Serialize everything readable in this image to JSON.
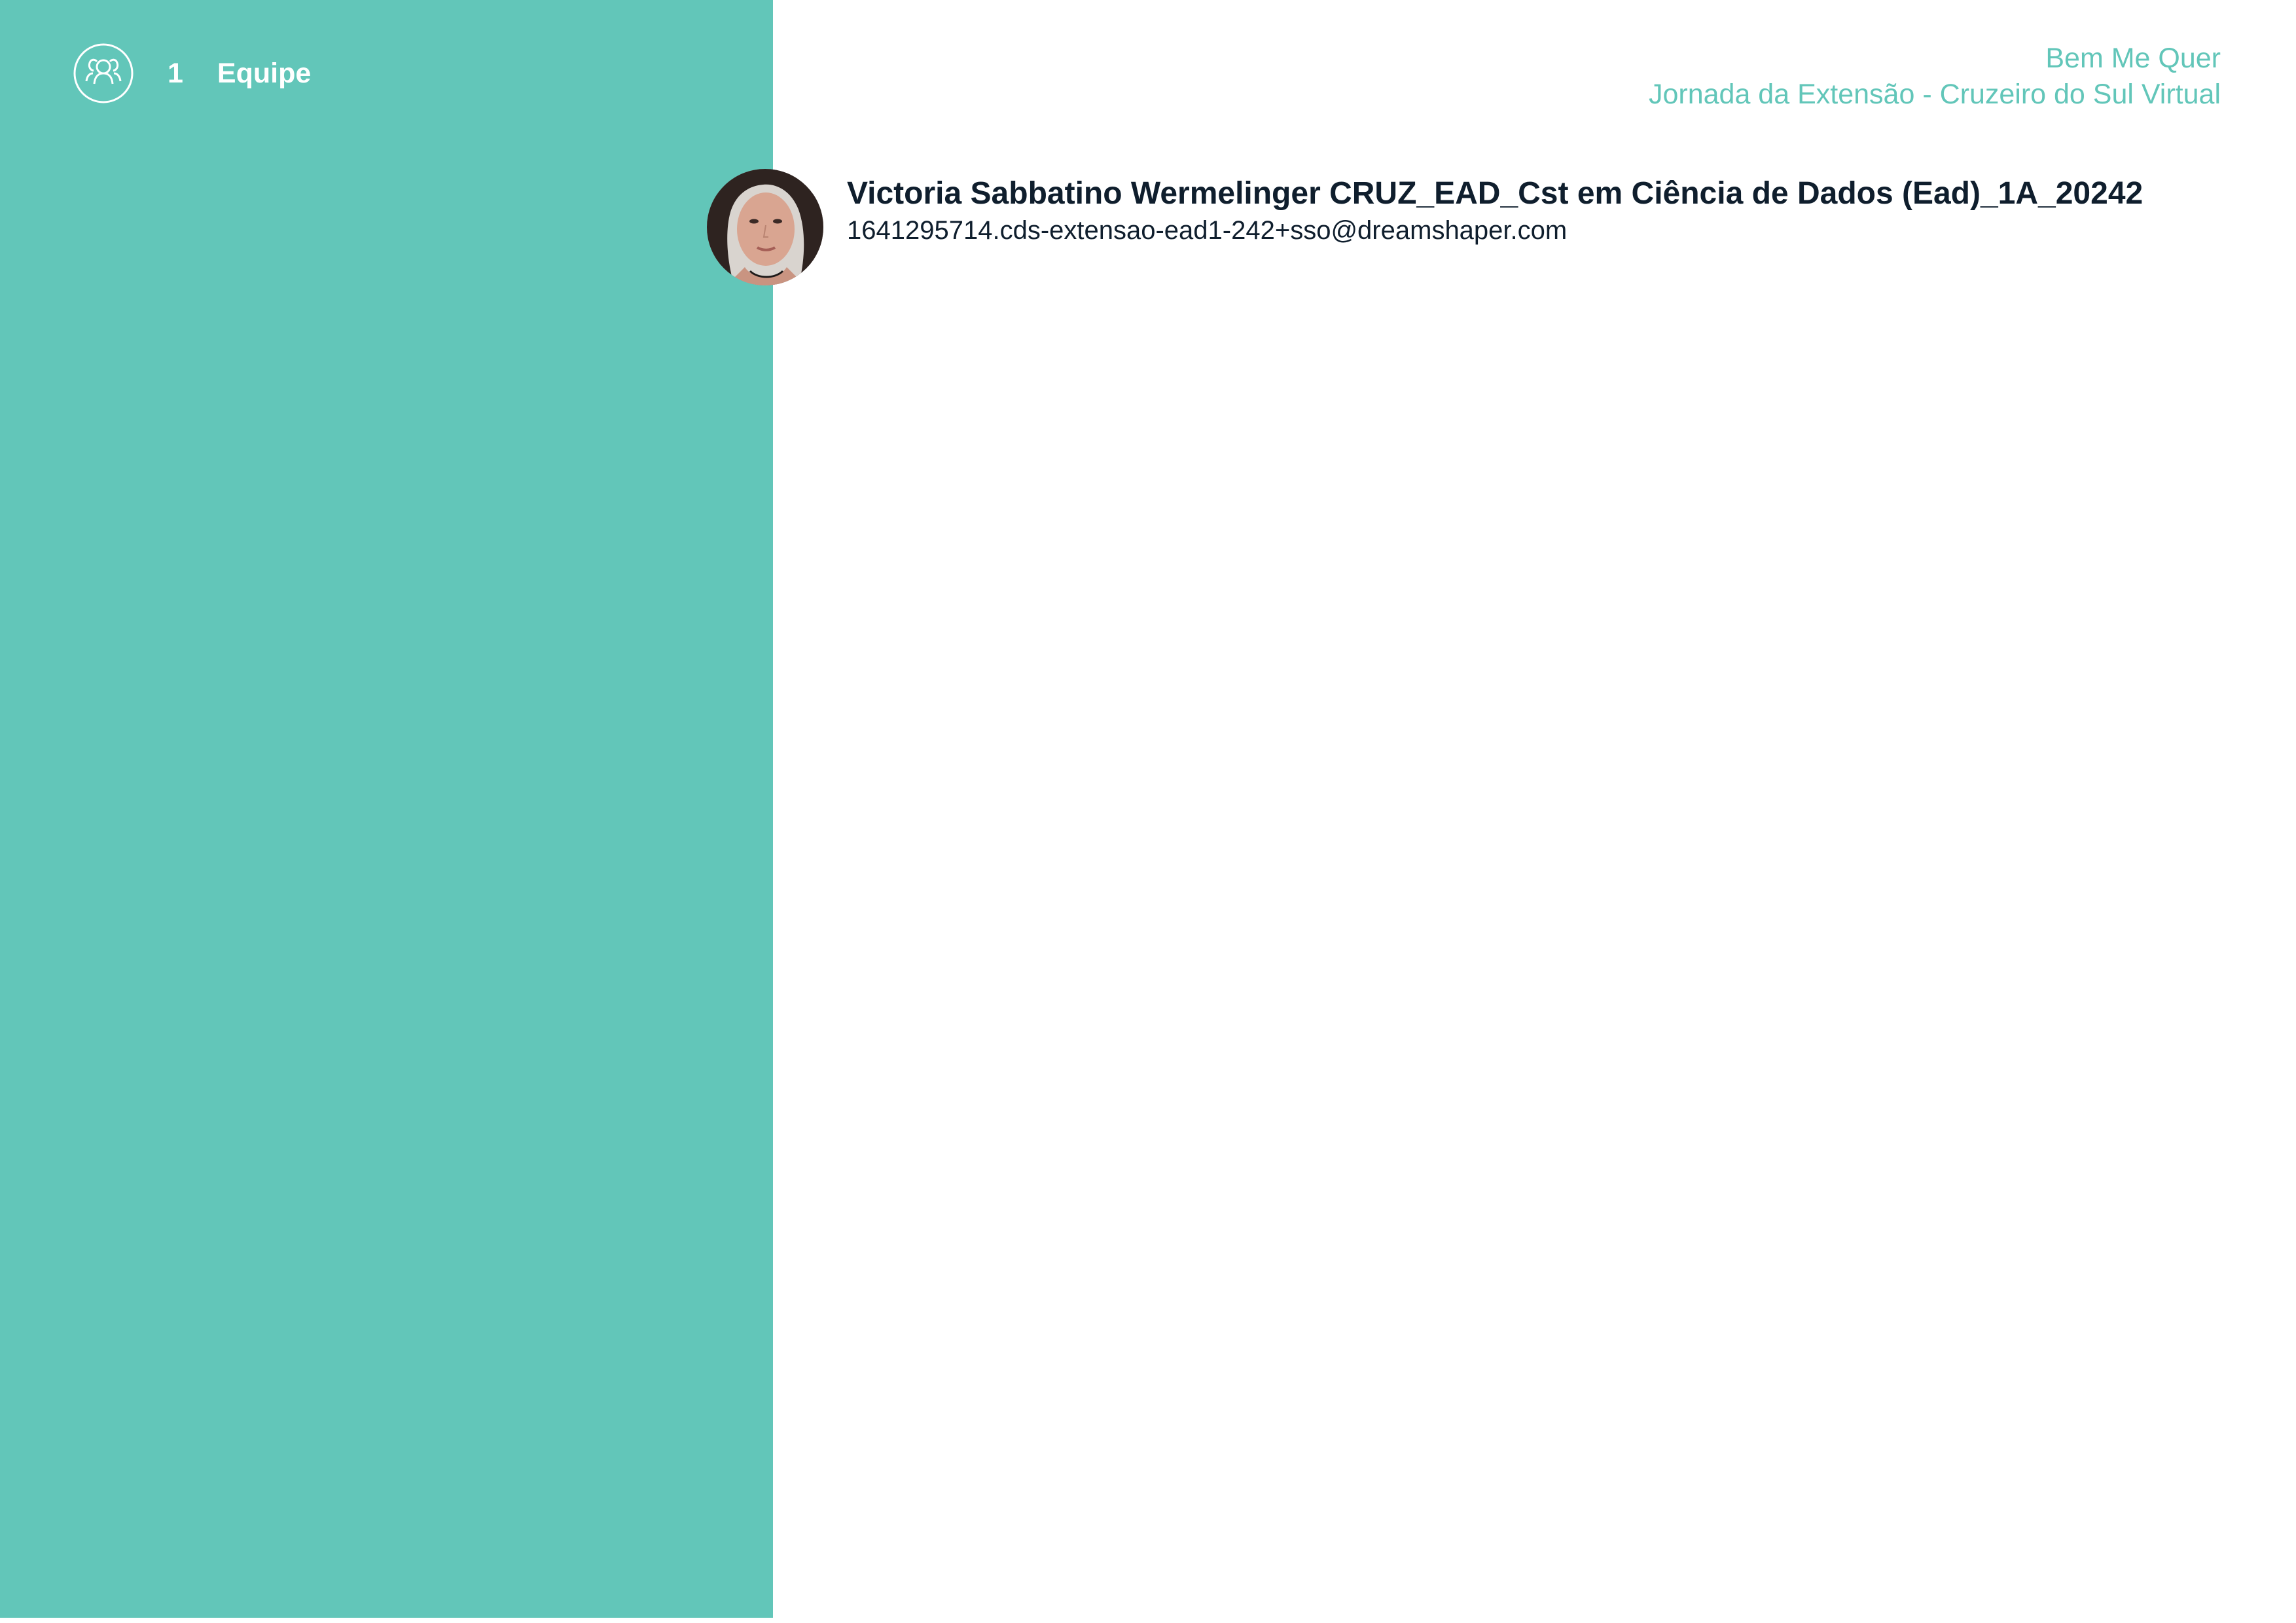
{
  "section": {
    "number": "1",
    "title": "Equipe",
    "icon": "team-icon"
  },
  "project": {
    "name": "Bem Me Quer",
    "program": "Jornada da Extensão - Cruzeiro do Sul Virtual"
  },
  "members": [
    {
      "name": "Victoria Sabbatino Wermelinger CRUZ_EAD_Cst em Ciência de Dados (Ead)_1A_20242",
      "email": "1641295714.cds-extensao-ead1-242+sso@dreamshaper.com"
    }
  ],
  "colors": {
    "accent": "#62c6b9",
    "text_dark": "#0f1e2d",
    "white": "#ffffff"
  }
}
